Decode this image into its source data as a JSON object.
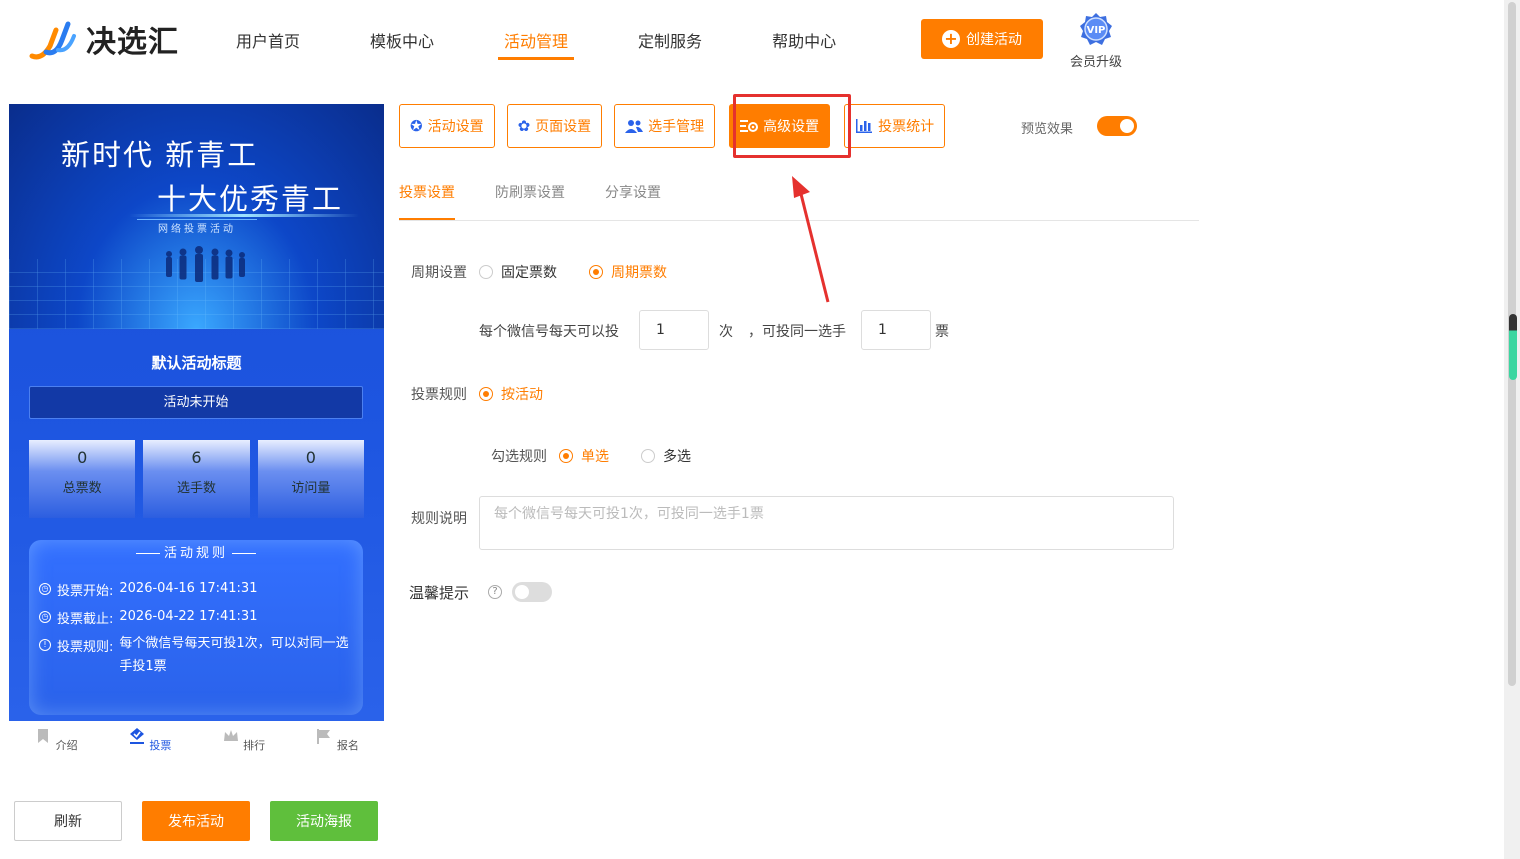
{
  "brand": {
    "name": "决选汇"
  },
  "nav": [
    {
      "label": "用户首页"
    },
    {
      "label": "模板中心"
    },
    {
      "label": "活动管理"
    },
    {
      "label": "定制服务"
    },
    {
      "label": "帮助中心"
    }
  ],
  "header": {
    "create_label": "创建活动",
    "vip_label": "会员升级",
    "vip_text": "VIP"
  },
  "preview": {
    "banner_line1": "新时代 新青工",
    "banner_line2": "十大优秀青工",
    "banner_sub": "网络投票活动",
    "title": "默认活动标题",
    "status": "活动未开始",
    "stats": [
      {
        "value": "0",
        "label": "总票数"
      },
      {
        "value": "6",
        "label": "选手数"
      },
      {
        "value": "0",
        "label": "访问量"
      }
    ],
    "rules_heading": "活动规则",
    "rules": [
      {
        "key": "投票开始:",
        "value": "2026-04-16 17:41:31"
      },
      {
        "key": "投票截止:",
        "value": "2026-04-22 17:41:31"
      },
      {
        "key": "投票规则:",
        "value": "每个微信号每天可投1次，可以对同一选手投1票"
      }
    ],
    "tabs": [
      {
        "label": "介绍"
      },
      {
        "label": "投票"
      },
      {
        "label": "排行"
      },
      {
        "label": "报名"
      }
    ]
  },
  "bottom_buttons": {
    "refresh": "刷新",
    "publish": "发布活动",
    "poster": "活动海报"
  },
  "toolbar": {
    "buttons": [
      {
        "label": "活动设置"
      },
      {
        "label": "页面设置"
      },
      {
        "label": "选手管理"
      },
      {
        "label": "高级设置"
      },
      {
        "label": "投票统计"
      }
    ],
    "preview_label": "预览效果"
  },
  "subtabs": [
    {
      "label": "投票设置"
    },
    {
      "label": "防刷票设置"
    },
    {
      "label": "分享设置"
    }
  ],
  "form": {
    "period_label": "周期设置",
    "period_fixed": "固定票数",
    "period_cycle": "周期票数",
    "per_day_text": "每个微信号每天可以投",
    "per_day_value": "1",
    "times_unit": "次",
    "same_player_text": "，可投同一选手",
    "same_player_value": "1",
    "votes_unit": "票",
    "rule_label": "投票规则",
    "rule_by_activity": "按活动",
    "select_rule_label": "勾选规则",
    "single": "单选",
    "multi": "多选",
    "desc_label": "规则说明",
    "desc_placeholder": "每个微信号每天可投1次，可投同一选手1票",
    "tip_label": "温馨提示"
  }
}
